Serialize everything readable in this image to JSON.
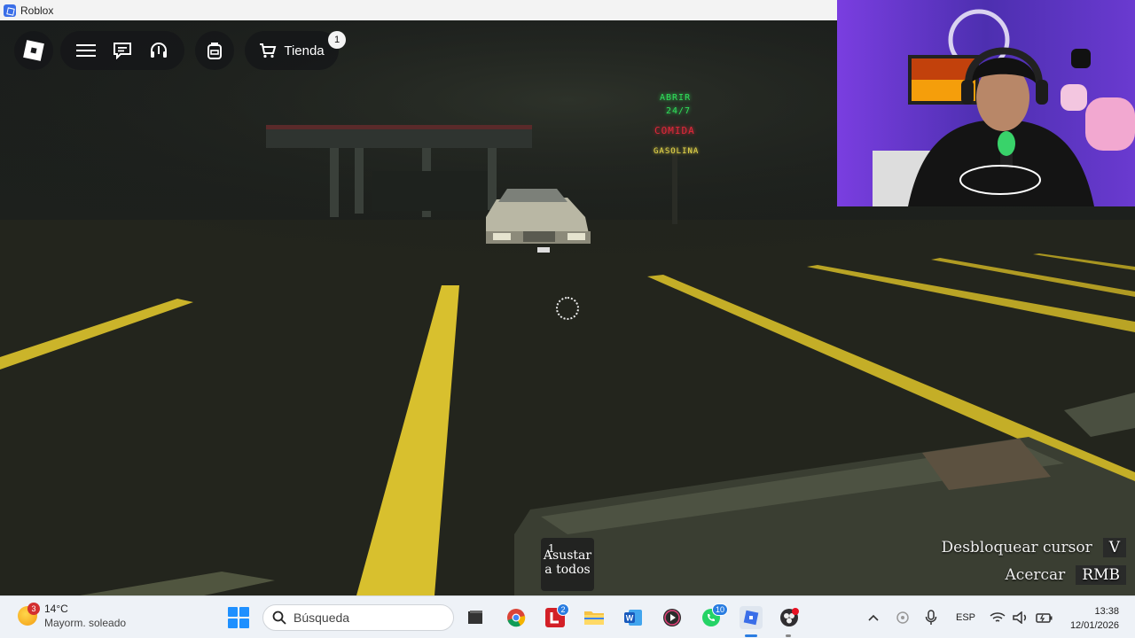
{
  "window": {
    "title": "Roblox"
  },
  "topbar": {
    "menu_icon": "hamburger-menu-icon",
    "chat_icon": "chat-icon",
    "voice_icon": "headset-icon",
    "backpack_icon": "backpack-icon",
    "shop_label": "Tienda",
    "shop_badge": "1"
  },
  "scene": {
    "signs": [
      "ABRIR",
      "24/7",
      "COMIDA",
      "GASOLINA"
    ],
    "sign_colors": {
      "open": "#2fe05a",
      "food": "#e0283a",
      "gas": "#e8d84a"
    },
    "line_color": "#d9c431"
  },
  "ability": {
    "slot": "1",
    "label_line1": "Asustar",
    "label_line2": "a todos"
  },
  "hints": [
    {
      "text": "Desbloquear cursor",
      "key": "V"
    },
    {
      "text": "Acercar",
      "key": "RMB"
    }
  ],
  "taskbar": {
    "weather_badge": "3",
    "temperature": "14°C",
    "condition": "Mayorm. soleado",
    "search_placeholder": "Búsqueda",
    "apps": [
      {
        "name": "file-manager-icon"
      },
      {
        "name": "chrome-icon"
      },
      {
        "name": "l-app-icon",
        "badge": "2"
      },
      {
        "name": "file-explorer-icon"
      },
      {
        "name": "word-icon"
      },
      {
        "name": "media-player-icon"
      },
      {
        "name": "whatsapp-icon",
        "badge": "10"
      },
      {
        "name": "roblox-icon"
      },
      {
        "name": "obs-icon"
      }
    ],
    "language": "ESP",
    "time": "13:38",
    "date": "12/01/2026"
  }
}
